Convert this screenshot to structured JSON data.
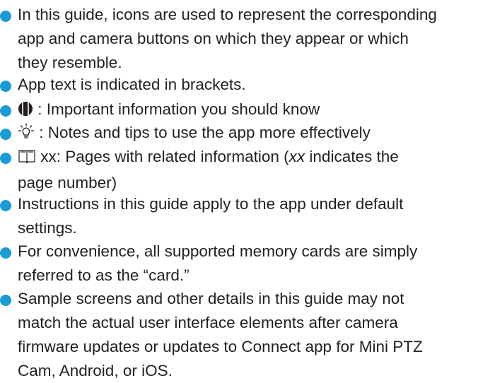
{
  "colors": {
    "bullet": "#1a9ad6",
    "text": "#231f20"
  },
  "bullets": {
    "icons_intro": {
      "line1": "In this guide, icons are used to represent the corresponding",
      "line2": "app and camera buttons on which they appear or which",
      "line3": "they resemble."
    },
    "brackets": {
      "line1": "App text is indicated in brackets."
    },
    "important": {
      "icon": "important-info-icon",
      "text": " : Important information you should know"
    },
    "notes": {
      "icon": "lightbulb-tips-icon",
      "text": " : Notes and tips to use the app more effectively"
    },
    "pages": {
      "icon": "book-pages-icon",
      "text_pre": " xx: Pages with related information (",
      "text_em": "xx",
      "text_post": " indicates the",
      "line2": "page number)"
    },
    "defaults": {
      "line1": "Instructions in this guide apply to the app under default",
      "line2": "settings."
    },
    "cards": {
      "line1": "For convenience, all supported memory cards are simply",
      "line2": "referred to as the “card.”"
    },
    "screens": {
      "line1": "Sample screens and other details in this guide may not",
      "line2": "match the actual user interface elements after camera",
      "line3": "firmware updates or updates to Connect app for Mini PTZ",
      "line4": "Cam, Android, or iOS."
    }
  }
}
